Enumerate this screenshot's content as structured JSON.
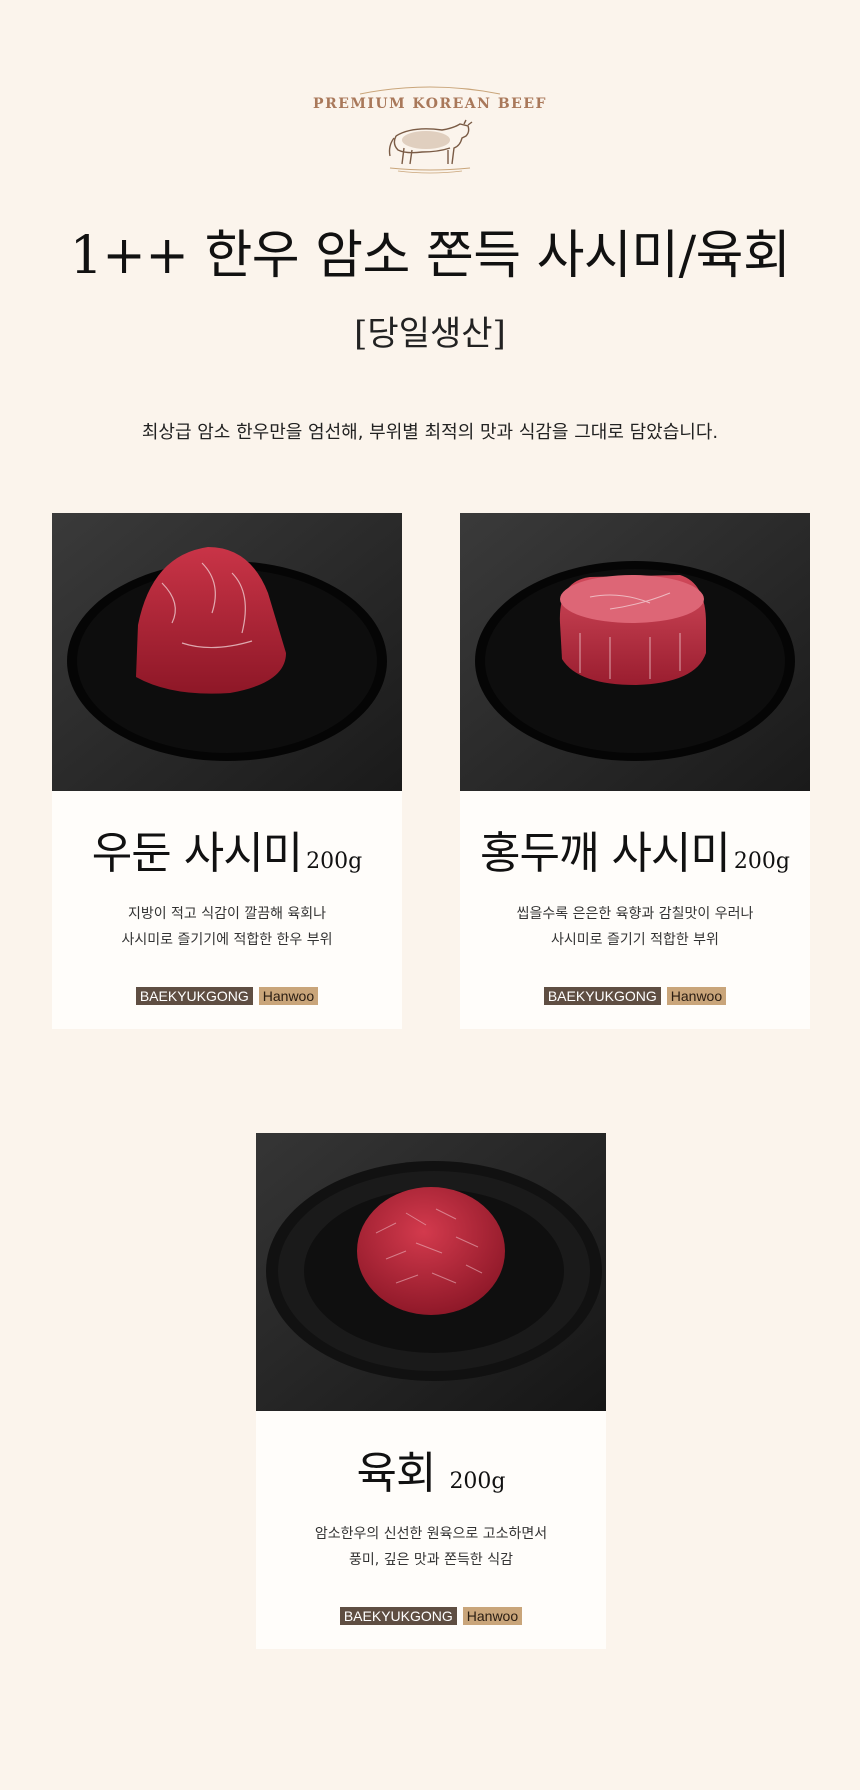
{
  "logo": {
    "text": "PREMIUM KOREAN BEEF",
    "icon": "cow-icon"
  },
  "header": {
    "title": "1++ 한우 암소 쫀득 사시미/육회",
    "subtitle": "[당일생산]",
    "tagline": "최상급 암소 한우만을 엄선해, 부위별 최적의 맛과 식감을 그대로 담았습니다."
  },
  "products": [
    {
      "name": "우둔 사시미",
      "weight": "200g",
      "desc_line1": "지방이 적고 식감이 깔끔해 육회나",
      "desc_line2": "사시미로 즐기기에 적합한 한우 부위",
      "badge_brand": "BAEKYUKGONG",
      "badge_type": "Hanwoo"
    },
    {
      "name": "홍두깨 사시미",
      "weight": "200g",
      "desc_line1": "씹을수록 은은한 육향과 감칠맛이 우러나",
      "desc_line2": "사시미로 즐기기 적합한 부위",
      "badge_brand": "BAEKYUKGONG",
      "badge_type": "Hanwoo"
    },
    {
      "name": "육회",
      "weight": "200g",
      "desc_line1": "암소한우의 신선한 원육으로 고소하면서",
      "desc_line2": "풍미, 깊은 맛과 쫀득한 식감",
      "badge_brand": "BAEKYUKGONG",
      "badge_type": "Hanwoo"
    }
  ],
  "colors": {
    "background": "#fbf4ec",
    "card": "#fffdfa",
    "accent_brown": "#a9785a",
    "badge_dark": "#5f4e42",
    "badge_light": "#c9a57a"
  }
}
